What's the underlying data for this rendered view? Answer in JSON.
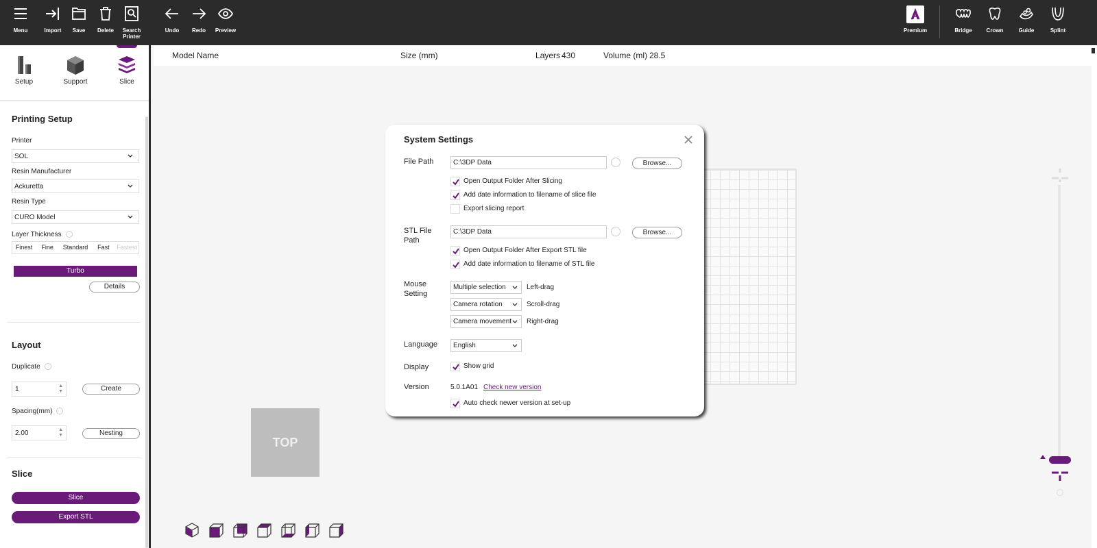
{
  "toolbar": {
    "left": [
      {
        "name": "menu",
        "label": "Menu"
      },
      {
        "name": "import",
        "label": "Import"
      },
      {
        "name": "save",
        "label": "Save"
      },
      {
        "name": "delete",
        "label": "Delete"
      },
      {
        "name": "search-printer",
        "label": "Search Printer"
      },
      {
        "name": "undo",
        "label": "Undo"
      },
      {
        "name": "redo",
        "label": "Redo"
      },
      {
        "name": "preview",
        "label": "Preview"
      }
    ],
    "right": [
      {
        "name": "premium",
        "label": "Premium"
      },
      {
        "name": "bridge",
        "label": "Bridge"
      },
      {
        "name": "crown",
        "label": "Crown"
      },
      {
        "name": "guide",
        "label": "Guide"
      },
      {
        "name": "splint",
        "label": "Splint"
      }
    ]
  },
  "tabs": [
    {
      "name": "setup",
      "label": "Setup"
    },
    {
      "name": "support",
      "label": "Support"
    },
    {
      "name": "slice",
      "label": "Slice"
    }
  ],
  "printing_setup": {
    "title": "Printing Setup",
    "printer_label": "Printer",
    "printer_value": "SOL",
    "resin_manufacturer_label": "Resin Manufacturer",
    "resin_manufacturer_value": "Ackuretta",
    "resin_type_label": "Resin Type",
    "resin_type_value": "CURO Model",
    "layer_thickness_label": "Layer Thickness",
    "thickness_options": [
      "Finest",
      "Fine",
      "Standard",
      "Fast",
      "Fastest"
    ],
    "turbo_label": "Turbo",
    "details_label": "Details"
  },
  "layout": {
    "title": "Layout",
    "duplicate_label": "Duplicate",
    "duplicate_value": "1",
    "create_label": "Create",
    "spacing_label": "Spacing(mm)",
    "spacing_value": "2.00",
    "nesting_label": "Nesting"
  },
  "slice_section": {
    "title": "Slice",
    "slice_label": "Slice",
    "export_label": "Export STL"
  },
  "header": {
    "model_name": "Model Name",
    "size": "Size (mm)",
    "layers_label": "Layers",
    "layers_value": "430",
    "volume_label": "Volume (ml)",
    "volume_value": "28.5"
  },
  "viewport": {
    "top_cube_label": "TOP"
  },
  "colors": {
    "accent": "#6a1b7a",
    "toolbar_bg": "#2b2b2b",
    "viewport_bg": "#f5f5f5"
  },
  "dialog": {
    "title": "System Settings",
    "file_path_label": "File Path",
    "file_path_value": "C:\\3DP Data",
    "browse_label": "Browse...",
    "file_checks": [
      {
        "label": "Open Output Folder After Slicing",
        "checked": true
      },
      {
        "label": "Add date information to filename of slice file",
        "checked": true
      },
      {
        "label": "Export slicing report",
        "checked": false
      }
    ],
    "stl_path_label": "STL File Path",
    "stl_path_value": "C:\\3DP Data",
    "stl_checks": [
      {
        "label": "Open Output Folder After Export STL file",
        "checked": true
      },
      {
        "label": "Add date information to filename of STL file",
        "checked": true
      }
    ],
    "mouse_label": "Mouse Setting",
    "mouse_rows": [
      {
        "value": "Multiple selection",
        "action": "Left-drag"
      },
      {
        "value": "Camera rotation",
        "action": "Scroll-drag"
      },
      {
        "value": "Camera movement",
        "action": "Right-drag"
      }
    ],
    "language_label": "Language",
    "language_value": "English",
    "display_label": "Display",
    "show_grid_label": "Show grid",
    "show_grid_checked": true,
    "version_label": "Version",
    "version_value": "5.0.1A01",
    "check_version_label": "Check new version",
    "auto_check_label": "Auto check newer version at set-up",
    "auto_check_checked": true
  }
}
